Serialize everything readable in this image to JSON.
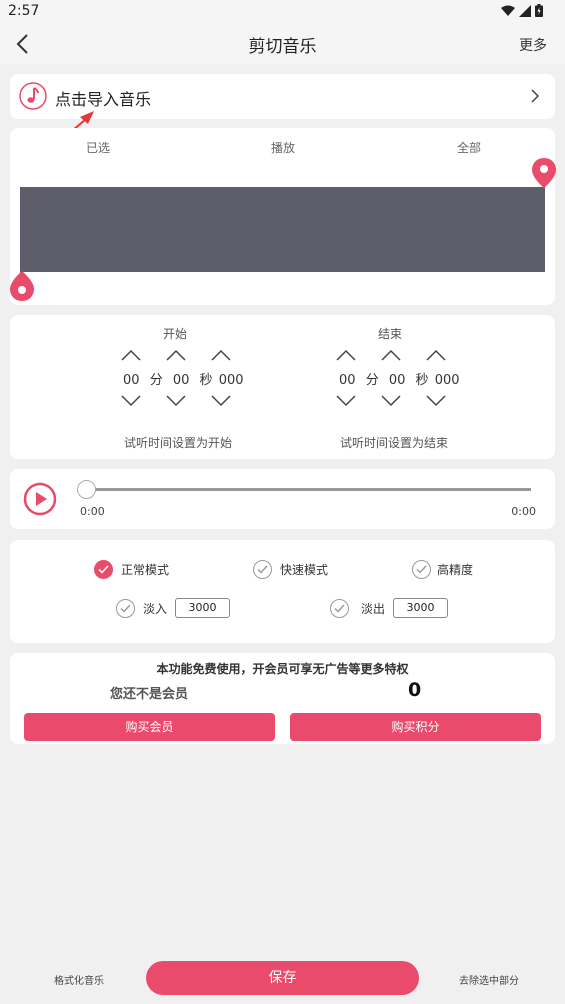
{
  "status_bar": {
    "time": "2:57"
  },
  "header": {
    "title": "剪切音乐",
    "more_label": "更多"
  },
  "import": {
    "label": "点击导入音乐"
  },
  "waveform": {
    "options": [
      "已选",
      "播放",
      "全部"
    ]
  },
  "time_settings": {
    "start": {
      "label": "开始",
      "minutes": "00",
      "min_unit": "分",
      "seconds": "00",
      "sec_unit": "秒",
      "millis": "000",
      "hint": "试听时间设置为开始"
    },
    "end": {
      "label": "结束",
      "minutes": "00",
      "min_unit": "分",
      "seconds": "00",
      "sec_unit": "秒",
      "millis": "000",
      "hint": "试听时间设置为结束"
    }
  },
  "player": {
    "current_time": "0:00",
    "total_time": "0:00",
    "progress": 0
  },
  "modes": {
    "normal": {
      "label": "正常模式",
      "checked": true
    },
    "fast": {
      "label": "快速模式",
      "checked": false
    },
    "high_precision": {
      "label": "高精度",
      "checked": false
    },
    "fade_in": {
      "label": "淡入",
      "value": "3000",
      "checked": false
    },
    "fade_out": {
      "label": "淡出",
      "value": "3000",
      "checked": false
    }
  },
  "vip": {
    "notice": "本功能免费使用，开会员可享无广告等更多特权",
    "status": "您还不是会员",
    "points": "0",
    "buy_vip_label": "购买会员",
    "buy_points_label": "购买积分"
  },
  "bottom": {
    "format_label": "格式化音乐",
    "save_label": "保存",
    "remove_label": "去除选中部分"
  },
  "colors": {
    "accent": "#ea4a6b",
    "waveform": "#5e5e6a",
    "background": "#f0f0f0"
  }
}
